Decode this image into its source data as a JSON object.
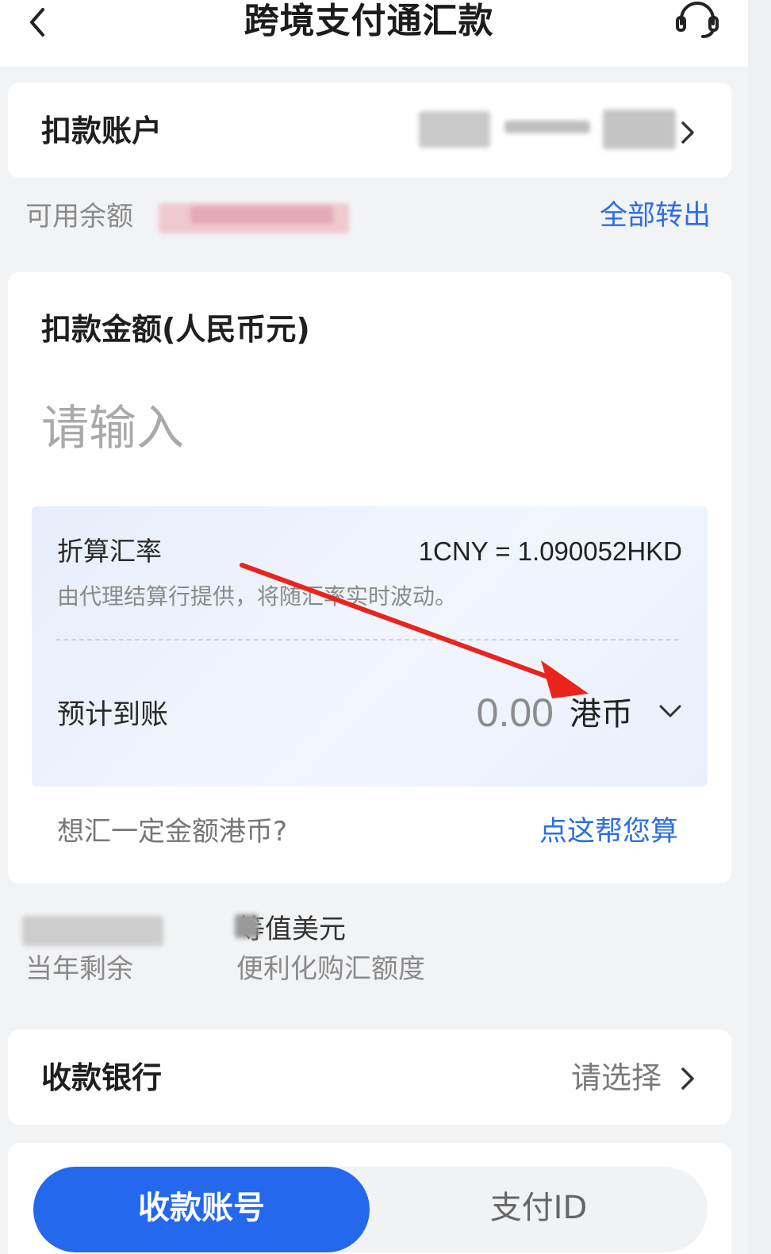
{
  "header": {
    "title": "跨境支付通汇款"
  },
  "debit_account": {
    "label": "扣款账户"
  },
  "balance": {
    "label": "可用余额",
    "transfer_all_label": "全部转出"
  },
  "amount": {
    "label": "扣款金额(人民币元)",
    "placeholder": "请输入",
    "rate_label": "折算汇率",
    "rate_value": "1CNY = 1.090052HKD",
    "rate_note": "由代理结算行提供，将随汇率实时波动。",
    "expected_label": "预计到账",
    "expected_value": "0.00",
    "currency": "港币",
    "hint": "想汇一定金额港币?",
    "calc_link": "点这帮您算"
  },
  "quota": {
    "remaining_label": "当年剩余",
    "usd_label": "等值美元",
    "desc_label": "便利化购汇额度"
  },
  "payee_bank": {
    "label": "收款银行",
    "select_label": "请选择"
  },
  "tabs": [
    {
      "label": "收款账号",
      "active": true
    },
    {
      "label": "支付ID",
      "active": false
    }
  ],
  "colors": {
    "accent": "#2468ee",
    "link": "#2c6de8",
    "annotation_arrow": "#e8241c"
  },
  "icons": {
    "back": "chevron-left-icon",
    "support": "headset-icon",
    "account_arrow": "chevron-right-icon",
    "currency_dropdown": "chevron-down-icon",
    "bank_arrow": "chevron-right-icon"
  }
}
